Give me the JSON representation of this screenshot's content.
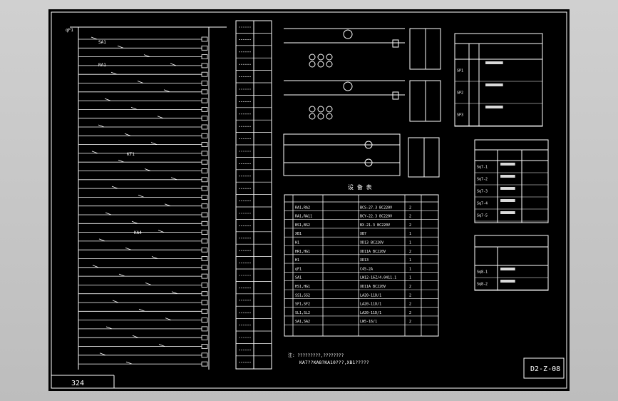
{
  "page_number": "324",
  "drawing_number": "D2-Z-08",
  "equipment_table": {
    "title": "设 备 表",
    "group_rows": [
      {
        "code": "RA1,RA2",
        "spec": "BCS-27.3 BC220V",
        "qty": "2"
      },
      {
        "code": "RA1,RA11",
        "spec": "BCY-22.3 BC220V",
        "qty": "2"
      },
      {
        "code": "BS1,BS2",
        "spec": "BX-21.3 BC220V",
        "qty": "2"
      },
      {
        "code": "XB1",
        "spec": "XB7",
        "qty": "1"
      },
      {
        "code": "H1",
        "spec": "XD13 BC220V",
        "qty": "1"
      },
      {
        "code": "HR1,HG1",
        "spec": "XD11A BC220V",
        "qty": "2"
      },
      {
        "code": "H1",
        "spec": "XD13",
        "qty": "1"
      },
      {
        "code": "qF1",
        "spec": "C45-2A",
        "qty": "1"
      },
      {
        "code": "SA1",
        "spec": "LW12-16Z/4.0411.1",
        "qty": "1"
      },
      {
        "code": "HS1,HG1",
        "spec": "XD11A BC220V",
        "qty": "2"
      },
      {
        "code": "SS1,SS2",
        "spec": "LA20-11D/1",
        "qty": "2"
      },
      {
        "code": "SF1,SF2",
        "spec": "LA20-11D/1",
        "qty": "2"
      },
      {
        "code": "SL1,SL2",
        "spec": "LA20-11D/1",
        "qty": "2"
      },
      {
        "code": "SA1,SA2",
        "spec": "LW5-16/1",
        "qty": "2"
      }
    ]
  },
  "tables_right": {
    "table1_rows": [
      "SP1",
      "SP2",
      "SP3"
    ],
    "table2_rows": [
      "Sq7-1",
      "Sq7-2",
      "Sq7-3",
      "Sq7-4",
      "Sq7-5"
    ],
    "table3_rows": [
      "Sq8-1",
      "Sq8-2"
    ]
  },
  "note": {
    "line1": "注: ?????????,????????",
    "line2": "KA7??KA8?KA10???,XB1?????"
  },
  "labels": {
    "qf1": "qF1",
    "sa1": "SA1",
    "ra1": "RA1",
    "kt1": "KT1",
    "ka4": "KA4"
  }
}
